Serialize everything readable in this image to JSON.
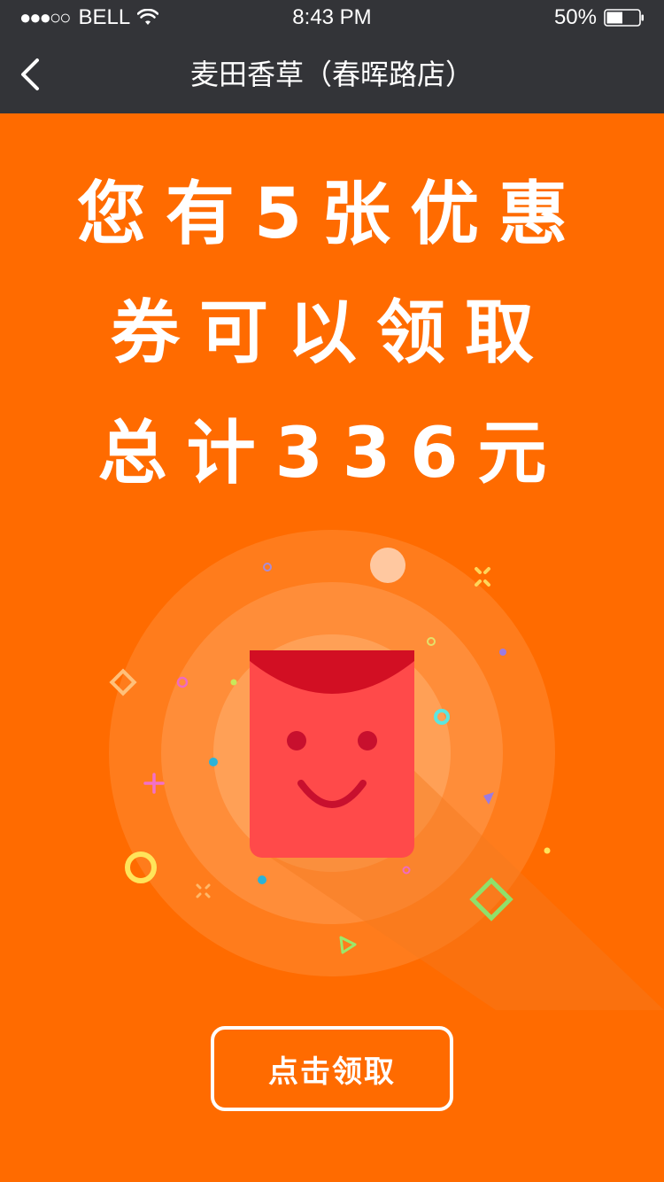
{
  "status_bar": {
    "signal": "●●●○○",
    "carrier": "BELL",
    "time": "8:43 PM",
    "battery": "50%",
    "battery_level": 0.5
  },
  "nav": {
    "back_icon": "chevron-left-icon",
    "title": "麦田香草（春晖路店）"
  },
  "headline": {
    "line1": "您有5张优惠",
    "line2": "券可以领取",
    "line3": "总计336元"
  },
  "illustration": {
    "icon": "red-envelope-smiley-icon",
    "colors": {
      "envelope_body": "#FF4A4A",
      "envelope_flap": "#D20F23",
      "background": "#FF6B00"
    }
  },
  "claim_button": {
    "label": "点击领取"
  }
}
